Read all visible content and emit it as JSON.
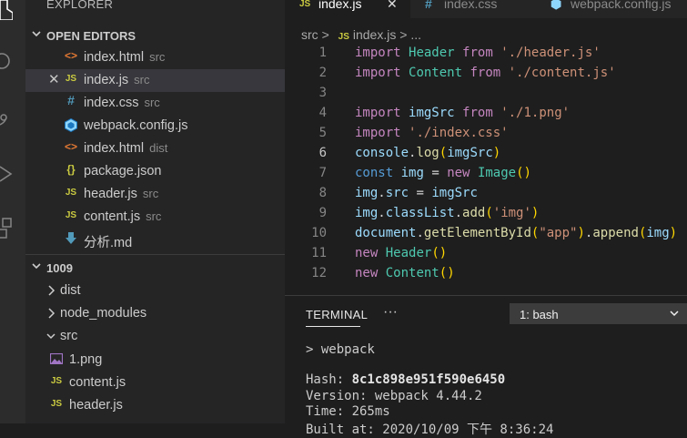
{
  "explorer": {
    "title": "EXPLORER",
    "open_editors": {
      "label": "OPEN EDITORS",
      "items": [
        {
          "icon": "html-file-icon",
          "name": "index.html",
          "dir": "src"
        },
        {
          "icon": "js-file-icon",
          "name": "index.js",
          "dir": "src",
          "active": true,
          "close": "✕"
        },
        {
          "icon": "css-file-icon",
          "name": "index.css",
          "dir": "src"
        },
        {
          "icon": "webpack-icon",
          "name": "webpack.config.js",
          "dir": ""
        },
        {
          "icon": "html-file-icon",
          "name": "index.html",
          "dir": "dist"
        },
        {
          "icon": "json-file-icon",
          "name": "package.json",
          "dir": ""
        },
        {
          "icon": "js-file-icon",
          "name": "header.js",
          "dir": "src"
        },
        {
          "icon": "js-file-icon",
          "name": "content.js",
          "dir": "src"
        },
        {
          "icon": "markdown-file-icon",
          "name": "分析.md",
          "dir": ""
        }
      ]
    },
    "project": {
      "label": "1009",
      "items": [
        {
          "name": "dist",
          "type": "folder",
          "expanded": false
        },
        {
          "name": "node_modules",
          "type": "folder",
          "expanded": false
        },
        {
          "name": "src",
          "type": "folder",
          "expanded": true
        },
        {
          "name": "1.png",
          "type": "image"
        },
        {
          "name": "content.js",
          "type": "js"
        },
        {
          "name": "header.js",
          "type": "js"
        }
      ]
    }
  },
  "tabs": [
    {
      "icon_text": "JS",
      "label": "index.js",
      "active": true,
      "close": "✕"
    },
    {
      "icon_text": "#",
      "label": "index.css",
      "active": false
    },
    {
      "icon_text": "⬢",
      "label": "webpack.config.js",
      "active": false
    }
  ],
  "breadcrumb": {
    "folder": "src",
    "sep": ">",
    "icon_text": "JS",
    "file": "index.js",
    "more": "..."
  },
  "code": {
    "current_line": 6,
    "lines": [
      {
        "n": "1",
        "text": "import Header from './header.js'"
      },
      {
        "n": "2",
        "text": "import Content from './content.js'"
      },
      {
        "n": "3",
        "text": ""
      },
      {
        "n": "4",
        "text": "import imgSrc from './1.png'"
      },
      {
        "n": "5",
        "text": "import './index.css'"
      },
      {
        "n": "6",
        "text": "console.log(imgSrc)"
      },
      {
        "n": "7",
        "text": "const img = new Image()"
      },
      {
        "n": "8",
        "text": "img.src = imgSrc"
      },
      {
        "n": "9",
        "text": "img.classList.add('img')"
      },
      {
        "n": "10",
        "text": "document.getElementById(\"app\").append(img)"
      },
      {
        "n": "11",
        "text": "new Header()"
      },
      {
        "n": "12",
        "text": "new Content()"
      }
    ]
  },
  "panel": {
    "tab": "TERMINAL",
    "more": "···",
    "terminal_select": "1: bash",
    "output": [
      "> webpack",
      "",
      "Hash: 8c1c898e951f590e6450",
      "Version: webpack 4.44.2",
      "Time: 265ms",
      "Built at: 2020/10/09 下午 8:36:24"
    ]
  },
  "colors": {
    "background": "#1e1e1e",
    "sidebar": "#252526",
    "activity_bar": "#2c2c2c",
    "keyword": "#c586c0",
    "string": "#ce9178",
    "variable": "#9cdcfe",
    "class": "#4ec9b0",
    "function": "#dcdcaa"
  }
}
